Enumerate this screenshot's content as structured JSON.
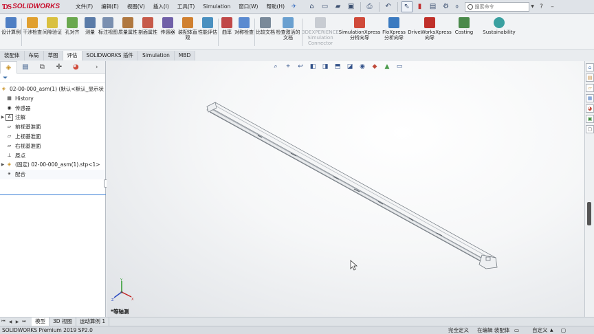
{
  "app": {
    "brand": "SOLIDWORKS"
  },
  "menu": [
    "文件(F)",
    "编辑(E)",
    "视图(V)",
    "插入(I)",
    "工具(T)",
    "Simulation",
    "窗口(W)",
    "帮助(H)"
  ],
  "search": {
    "placeholder": "搜索命令"
  },
  "toolbar_partial_value": "0",
  "ribbon": [
    {
      "label": "设计算例",
      "color": "#4f7fc4"
    },
    {
      "label": "干涉检查",
      "color": "#e0a030"
    },
    {
      "label": "间隙验证",
      "color": "#d9c040"
    },
    {
      "label": "孔对齐",
      "color": "#6aa84f"
    },
    {
      "label": "测量",
      "color": "#5a7ba8"
    },
    {
      "label": "标注视图",
      "color": "#7a8fb0"
    },
    {
      "label": "质量属性",
      "color": "#b07840"
    },
    {
      "label": "剖面属性",
      "color": "#c65a4a"
    },
    {
      "label": "传感器",
      "color": "#7060a8"
    },
    {
      "label": "装配体直观",
      "color": "#d08030"
    },
    {
      "label": "性能评估",
      "color": "#4a90c0"
    },
    {
      "label": "曲率",
      "color": "#c04848"
    },
    {
      "label": "对称检查",
      "color": "#5a8ad0"
    },
    {
      "label": "比较文档",
      "color": "#7a8a9a"
    },
    {
      "label": "检查激活的文档",
      "color": "#6aa0d0"
    },
    {
      "label": "3DEXPERIENCE Simulation Connector",
      "color": "#c8ccd2",
      "dim": true
    },
    {
      "label": "SimulationXpress 分析向导",
      "color": "#d04a3a"
    },
    {
      "label": "FloXpress 分析向导",
      "color": "#3a7ac0"
    },
    {
      "label": "DriveWorksXpress 向导",
      "color": "#c0302a"
    },
    {
      "label": "Costing",
      "color": "#4a8a4a"
    },
    {
      "label": "Sustainability",
      "color": "#3aa0a0"
    }
  ],
  "command_tabs": [
    {
      "label": "装配体",
      "active": false
    },
    {
      "label": "布局",
      "active": false
    },
    {
      "label": "草图",
      "active": false
    },
    {
      "label": "评估",
      "active": true
    },
    {
      "label": "SOLIDWORKS 插件",
      "active": false
    },
    {
      "label": "Simulation",
      "active": false
    },
    {
      "label": "MBD",
      "active": false
    }
  ],
  "tree": {
    "root": "02-00-000_asm(1)  (默认<默认_显示状",
    "items": [
      {
        "label": "History",
        "icon": "history-icon"
      },
      {
        "label": "传感器",
        "icon": "sensor-icon"
      },
      {
        "label": "注解",
        "icon": "annotation-icon",
        "expandable": true
      },
      {
        "label": "前视基准面",
        "icon": "plane-icon"
      },
      {
        "label": "上视基准面",
        "icon": "plane-icon"
      },
      {
        "label": "右视基准面",
        "icon": "plane-icon"
      },
      {
        "label": "原点",
        "icon": "origin-icon"
      },
      {
        "label": "(固定) 02-00-000_asm(1).stp<1>",
        "icon": "part-icon",
        "expandable": true
      },
      {
        "label": "配合",
        "icon": "mate-icon"
      }
    ]
  },
  "view": {
    "orientation": "*等轴测"
  },
  "bottom_tabs": [
    {
      "label": "模型",
      "active": true
    },
    {
      "label": "3D 视图",
      "active": false
    },
    {
      "label": "运动算例 1",
      "active": false
    }
  ],
  "status": {
    "product": "SOLIDWORKS Premium 2019 SP2.0",
    "definition": "完全定义",
    "editing": "在编辑 装配体",
    "custom": "自定义"
  },
  "colors": {
    "accent": "#3a7fd5",
    "brand": "#c8102e"
  }
}
